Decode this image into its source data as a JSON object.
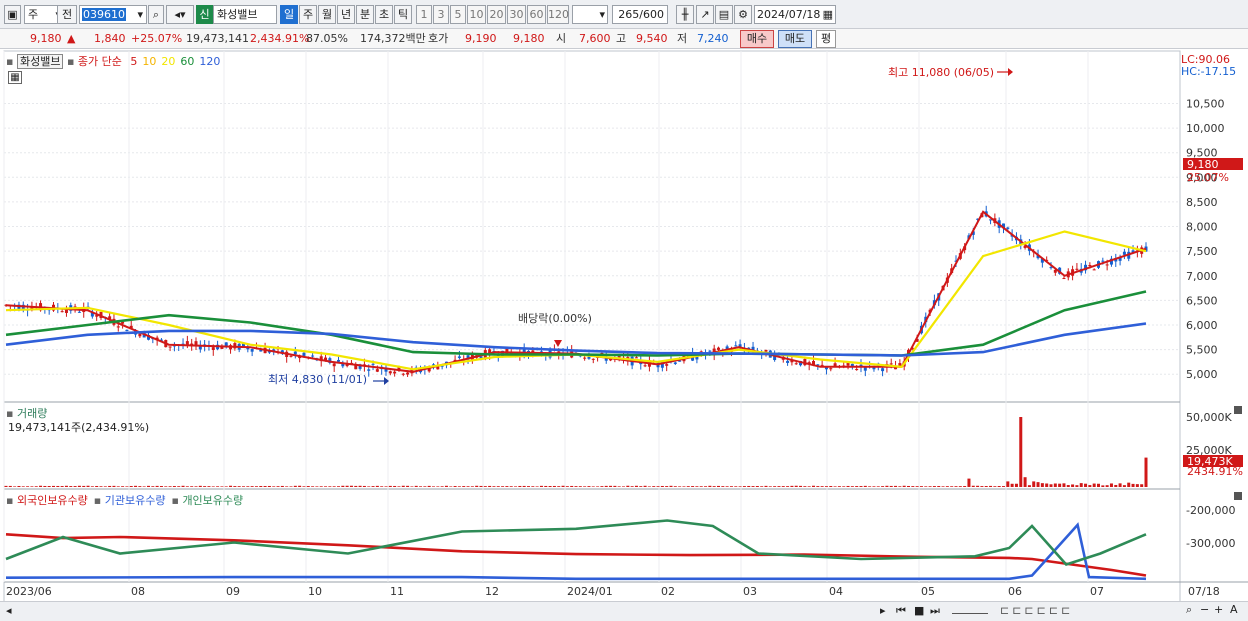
{
  "toolbar": {
    "chart_type": "주",
    "prev_label": "전",
    "stock_code": "039610",
    "new_badge": "신",
    "stock_name": "화성밸브",
    "periods": [
      "일",
      "주",
      "월",
      "년",
      "분",
      "초",
      "틱"
    ],
    "minute_intervals": [
      "1",
      "3",
      "5",
      "10",
      "20",
      "30",
      "60",
      "120"
    ],
    "count_display": "265",
    "count_total": "/600",
    "date": "2024/07/18"
  },
  "quote": {
    "price": "9,180",
    "change_arrow": "▲",
    "change": "1,840",
    "change_pct": "+25.07%",
    "volume": "19,473,141",
    "volume_pct": "2,434.91%",
    "turnover_pct": "87.05%",
    "amount": "174,372백만",
    "ask_label": "호가",
    "ask": "9,190",
    "bid": "9,180",
    "open_label": "시",
    "open": "7,600",
    "high_label": "고",
    "high": "9,540",
    "low_label": "저",
    "low": "7,240",
    "buy_label": "매수",
    "sell_label": "매도",
    "avg_label": "평"
  },
  "price_panel": {
    "tab_name": "화성밸브",
    "ma_label": "종가 단순",
    "ma_periods": [
      "5",
      "10",
      "20",
      "60",
      "120"
    ],
    "ma_colors": [
      "#d01818",
      "#f4b400",
      "#f2e600",
      "#1a8f3a",
      "#2f5fd8"
    ],
    "lc": "LC:90.06",
    "hc": "HC:-17.15",
    "annotation_high": "최고 11,080 (06/05)",
    "annotation_low": "최저 4,830 (11/01)",
    "annotation_div": "배당락(0.00%)",
    "last_price_tag": "9,180",
    "last_pct_tag": "25.07%",
    "y_ticks": [
      "10,500",
      "10,000",
      "9,500",
      "9,000",
      "8,500",
      "8,000",
      "7,500",
      "7,000",
      "6,500",
      "6,000",
      "5,500",
      "5,000"
    ]
  },
  "volume_panel": {
    "title": "거래량",
    "value_text": "19,473,141주(2,434.91%)",
    "y_ticks": [
      "50,000K",
      "25,000K"
    ],
    "last_tag": "19,473K",
    "last_pct": "2434.91%"
  },
  "holding_panel": {
    "series_labels": [
      "외국인보유수량",
      "기관보유수량",
      "개인보유수량"
    ],
    "series_colors": [
      "#d01818",
      "#2f5fd8",
      "#2e8b57"
    ],
    "y_ticks": [
      "-200,000",
      "-300,000"
    ]
  },
  "x_axis": {
    "labels": [
      "2023/06",
      "08",
      "09",
      "10",
      "11",
      "12",
      "2024/01",
      "02",
      "03",
      "04",
      "05",
      "06",
      "07",
      "07/18"
    ]
  },
  "chart_data": {
    "type": "line",
    "title": "",
    "xlabel": "",
    "ylabel": "",
    "ylim": [
      4700,
      11200
    ],
    "x": [
      "2023/06",
      "2023/07",
      "2023/08",
      "2023/09",
      "2023/10",
      "2023/11",
      "2023/12",
      "2024/01",
      "2024/02",
      "2024/03",
      "2024/04",
      "2024/05",
      "2024/06",
      "2024/07",
      "2024/07/18"
    ],
    "series": [
      {
        "name": "종가 단순 5",
        "values": [
          6400,
          6300,
          5600,
          5550,
          5250,
          5050,
          5450,
          5420,
          5200,
          5550,
          5150,
          5150,
          8300,
          7000,
          7550
        ]
      },
      {
        "name": "종가 단순 20",
        "values": [
          6300,
          6350,
          6000,
          5600,
          5400,
          5100,
          5350,
          5400,
          5250,
          5500,
          5300,
          5150,
          7400,
          7900,
          7500
        ]
      },
      {
        "name": "종가 단순 60",
        "values": [
          5800,
          6000,
          6200,
          6050,
          5800,
          5450,
          5400,
          5400,
          5380,
          5420,
          5400,
          5380,
          5600,
          6300,
          6680
        ]
      },
      {
        "name": "종가 단순 120",
        "values": [
          5600,
          5800,
          5880,
          5880,
          5820,
          5650,
          5550,
          5480,
          5430,
          5420,
          5400,
          5380,
          5450,
          5800,
          6030
        ]
      }
    ]
  }
}
